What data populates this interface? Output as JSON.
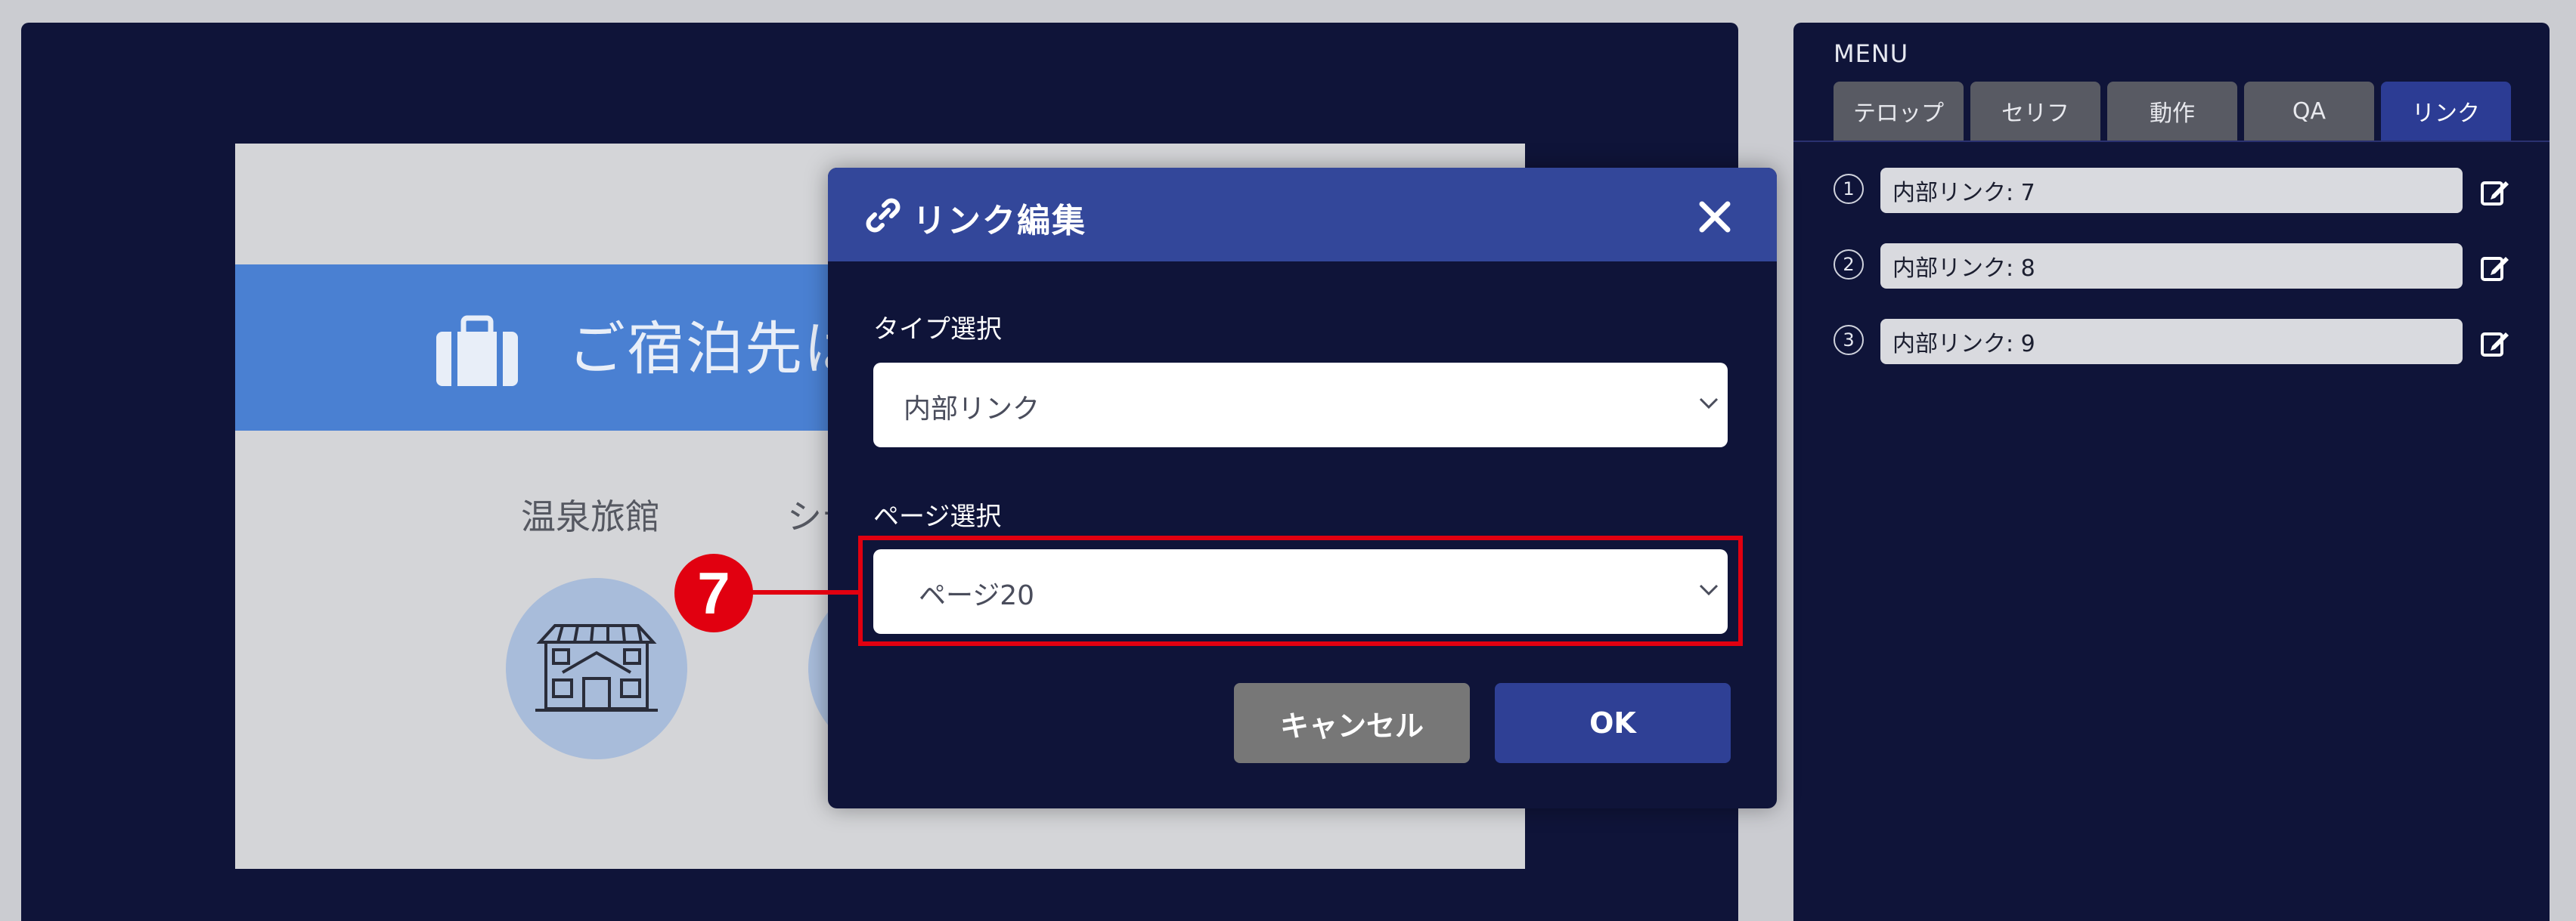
{
  "preview": {
    "banner_text": "ご宿泊先は",
    "categories": [
      {
        "label": "温泉旅館",
        "icon": "japanese-inn-icon"
      },
      {
        "label": "シテ",
        "icon": "building-icon"
      }
    ]
  },
  "menu": {
    "title": "MENU",
    "tabs": [
      {
        "label": "テロップ",
        "active": false
      },
      {
        "label": "セリフ",
        "active": false
      },
      {
        "label": "動作",
        "active": false
      },
      {
        "label": "QA",
        "active": false
      },
      {
        "label": "リンク",
        "active": true
      }
    ],
    "links": [
      {
        "num": "1",
        "value": "内部リンク: 7"
      },
      {
        "num": "2",
        "value": "内部リンク: 8"
      },
      {
        "num": "3",
        "value": "内部リンク: 9"
      }
    ]
  },
  "modal": {
    "title": "リンク編集",
    "type_label": "タイプ選択",
    "type_value": "内部リンク",
    "page_label": "ページ選択",
    "page_value": "ページ20",
    "cancel_label": "キャンセル",
    "ok_label": "OK"
  },
  "callout": {
    "number": "7"
  },
  "colors": {
    "background": "#cbccd1",
    "panel": "#0f1439",
    "modal_header": "#33479a",
    "active_tab": "#2c3c94",
    "highlight": "#e10010",
    "banner": "#4a80d2"
  }
}
